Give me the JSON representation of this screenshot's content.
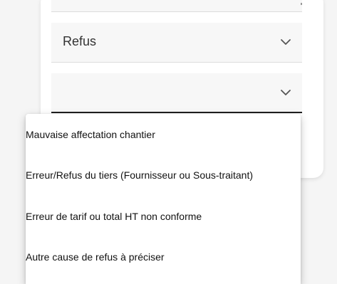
{
  "form": {
    "decision_field": {
      "value": "Refus"
    },
    "reason_field": {
      "value": ""
    }
  },
  "dropdown": {
    "options": [
      "Mauvaise affectation chantier",
      "Erreur/Refus du tiers (Fournisseur ou Sous-traitant)",
      "Erreur de tarif ou total HT non conforme",
      "Autre cause de refus à préciser"
    ]
  },
  "icons": {
    "decision_chevron": "chevron-down-icon",
    "reason_chevron": "chevron-down-icon"
  },
  "colors": {
    "background": "#f5f5f5",
    "card": "#ffffff",
    "field": "#f7f7f7",
    "text": "#333333",
    "active_underline": "#202020"
  }
}
